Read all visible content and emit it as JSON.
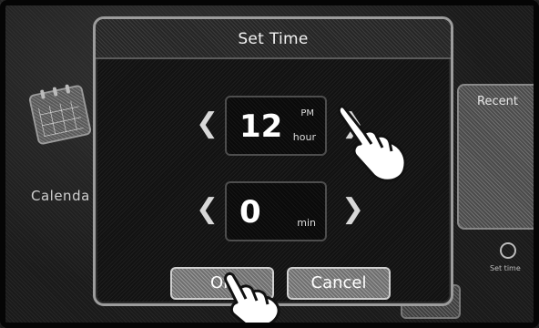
{
  "background": {
    "calendar_label": "Calenda",
    "recent_label": "Recent",
    "set_time_label": "Set time"
  },
  "dialog": {
    "title": "Set Time",
    "hour": {
      "value": "12",
      "ampm": "PM",
      "unit": "hour"
    },
    "minute": {
      "value": "0",
      "unit": "min"
    },
    "arrows": {
      "left": "❮",
      "right": "❯"
    },
    "buttons": {
      "ok": "OK",
      "cancel": "Cancel"
    }
  },
  "colors": {
    "dialog_border": "#9c9c9c",
    "text": "#ffffff"
  }
}
